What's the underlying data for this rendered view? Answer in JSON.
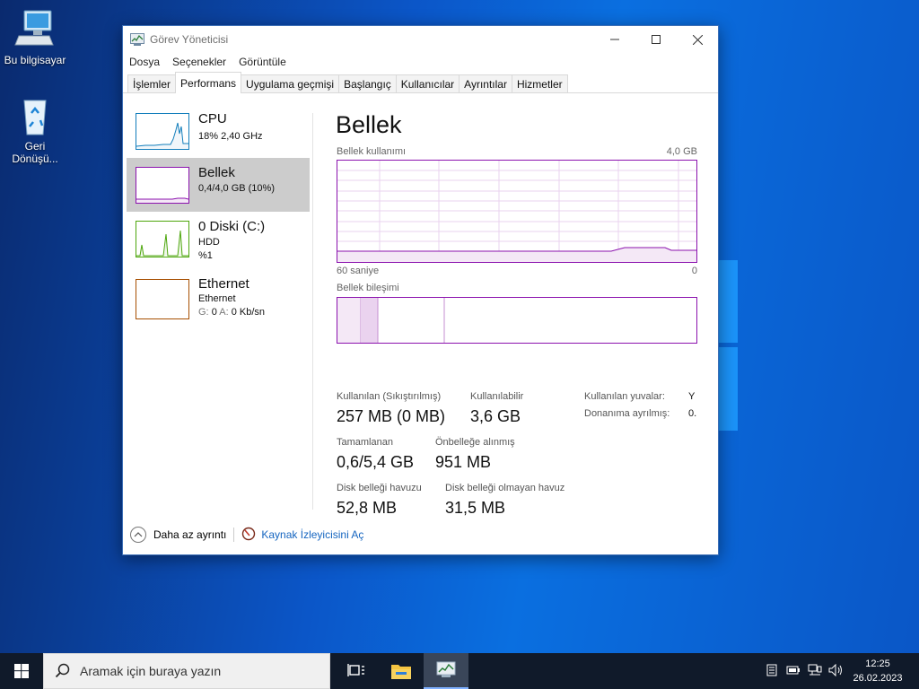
{
  "desktop": {
    "icons": [
      {
        "label": "Bu bilgisayar"
      },
      {
        "label": "Geri Dönüşü..."
      }
    ]
  },
  "window": {
    "title": "Görev Yöneticisi",
    "menu": [
      "Dosya",
      "Seçenekler",
      "Görüntüle"
    ],
    "tabs": [
      "İşlemler",
      "Performans",
      "Uygulama geçmişi",
      "Başlangıç",
      "Kullanıcılar",
      "Ayrıntılar",
      "Hizmetler"
    ],
    "active_tab": "Performans"
  },
  "sidebar": {
    "items": [
      {
        "title": "CPU",
        "sub1": "18%  2,40 GHz",
        "sub2": "",
        "color": "#117dbb"
      },
      {
        "title": "Bellek",
        "sub1": "0,4/4,0 GB (10%)",
        "sub2": "",
        "color": "#8b12ae"
      },
      {
        "title": "0 Diski (C:)",
        "sub1": "HDD",
        "sub2": "%1",
        "color": "#4da60c"
      },
      {
        "title": "Ethernet",
        "sub1": "Ethernet",
        "sub2_label_s": "G:",
        "sub2_val_s": "0",
        "sub2_label_r": "A:",
        "sub2_val_r": "0 Kb/sn",
        "color": "#a74f01"
      }
    ]
  },
  "main": {
    "heading": "Bellek",
    "usage_label": "Bellek kullanımı",
    "usage_max": "4,0 GB",
    "axis_left": "60 saniye",
    "axis_right": "0",
    "composition_label": "Bellek bileşimi",
    "stats": {
      "in_use_label": "Kullanılan (Sıkıştırılmış)",
      "in_use_value": "257 MB (0 MB)",
      "available_label": "Kullanılabilir",
      "available_value": "3,6 GB",
      "committed_label": "Tamamlanan",
      "committed_value": "0,6/5,4 GB",
      "cached_label": "Önbelleğe alınmış",
      "cached_value": "951 MB",
      "paged_label": "Disk belleği havuzu",
      "paged_value": "52,8 MB",
      "nonpaged_label": "Disk belleği olmayan havuz",
      "nonpaged_value": "31,5 MB"
    },
    "details": {
      "slots_label": "Kullanılan yuvalar:",
      "slots_value": "Y",
      "reserved_label": "Donanıma ayrılmış:",
      "reserved_value": "0."
    }
  },
  "footer": {
    "fewer_details": "Daha az ayrıntı",
    "resource_monitor": "Kaynak İzleyicisini Aç"
  },
  "taskbar": {
    "search_placeholder": "Aramak için buraya yazın",
    "time": "12:25",
    "date": "26.02.2023"
  },
  "chart_data": {
    "type": "area",
    "title": "",
    "ylabel": "Bellek kullanımı",
    "x_range_label": [
      "60 saniye",
      "0"
    ],
    "ylim_label": "4,0 GB",
    "usage_fraction_percent": 10,
    "composition": {
      "in_use_fraction": 0.065,
      "modified_fraction": 0.048,
      "standby_fraction": 0.185,
      "free_fraction": 0.702
    }
  }
}
